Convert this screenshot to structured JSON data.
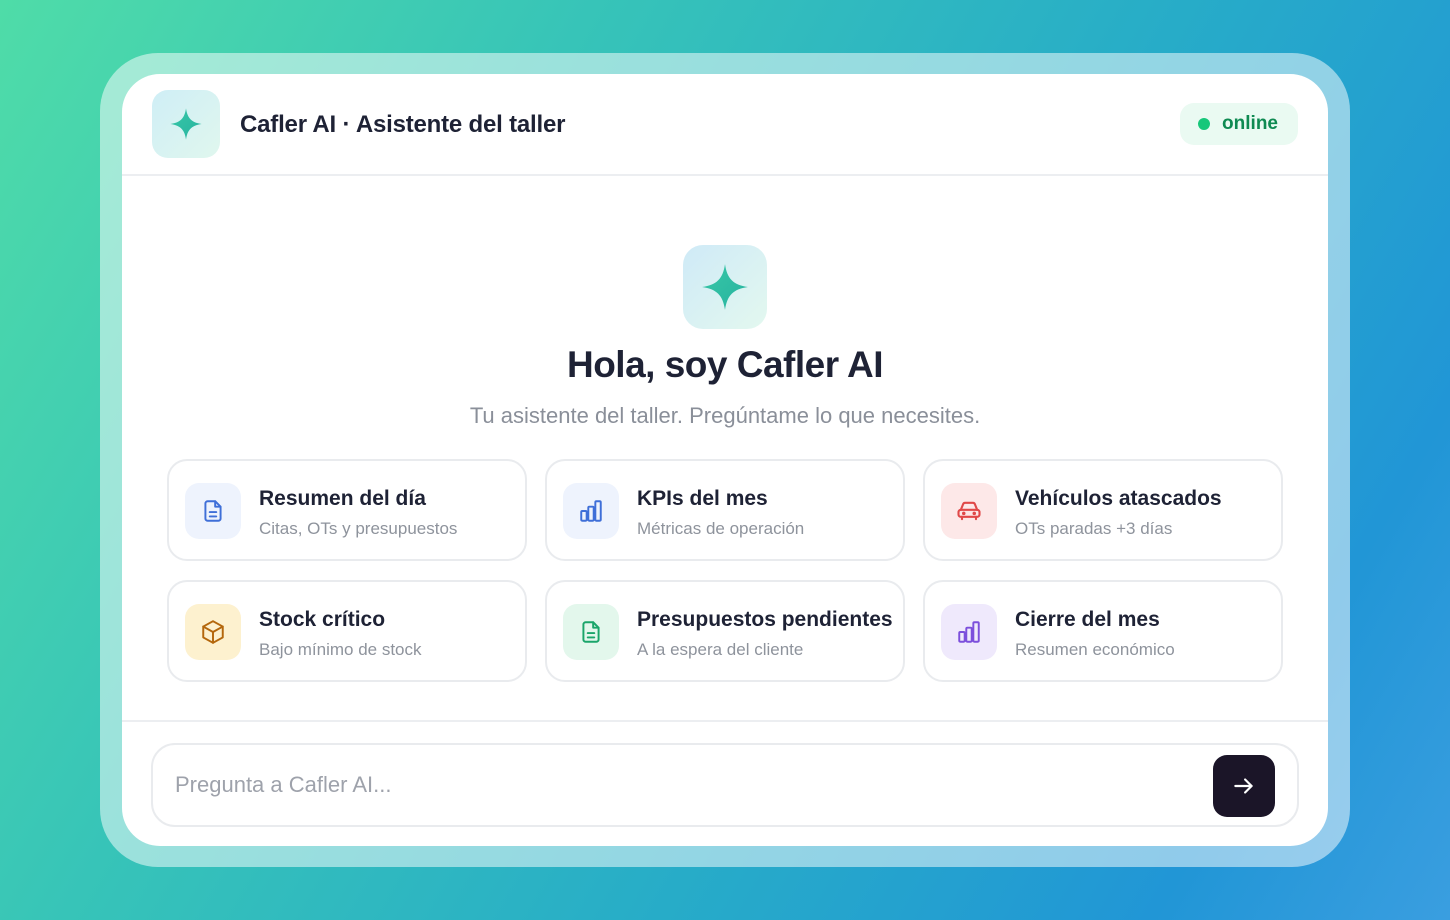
{
  "header": {
    "title": "Cafler AI · Asistente del taller",
    "status": "online",
    "logo_icon": "sparkle-icon"
  },
  "hero": {
    "icon": "sparkle-icon",
    "title": "Hola, soy Cafler AI",
    "subtitle": "Tu asistente del taller. Pregúntame lo que necesites."
  },
  "actions": [
    {
      "title": "Resumen del día",
      "subtitle": "Citas, OTs y presupuestos",
      "icon": "document-icon",
      "icon_color": "#3f6fd8",
      "icon_bg": "#eef3fd"
    },
    {
      "title": "KPIs del mes",
      "subtitle": "Métricas de operación",
      "icon": "bar-chart-icon",
      "icon_color": "#3f6fd8",
      "icon_bg": "#eef3fd"
    },
    {
      "title": "Vehículos atascados",
      "subtitle": "OTs paradas +3 días",
      "icon": "car-icon",
      "icon_color": "#e04848",
      "icon_bg": "#fde8e8"
    },
    {
      "title": "Stock crítico",
      "subtitle": "Bajo mínimo de stock",
      "icon": "box-icon",
      "icon_color": "#b4670c",
      "icon_bg": "#fdf1cf"
    },
    {
      "title": "Presupuestos pendientes",
      "subtitle": "A la espera del cliente",
      "icon": "document-icon",
      "icon_color": "#1aa56a",
      "icon_bg": "#e3f7ec"
    },
    {
      "title": "Cierre del mes",
      "subtitle": "Resumen económico",
      "icon": "bar-chart-icon",
      "icon_color": "#7c4fdc",
      "icon_bg": "#efe9fc"
    }
  ],
  "composer": {
    "placeholder": "Pregunta a Cafler AI...",
    "send_icon": "arrow-right-icon"
  },
  "colors": {
    "accent": "#2fc3a4",
    "status": "#17c77a",
    "send_button": "#1b1528"
  }
}
